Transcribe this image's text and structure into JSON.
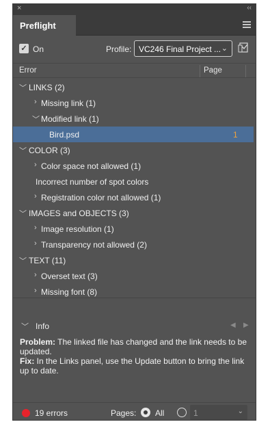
{
  "window": {
    "close_glyph": "×",
    "collapse_glyph": "‹‹"
  },
  "tabs": [
    {
      "label": "Preflight"
    }
  ],
  "menu_icon": "panel-menu-icon",
  "controls": {
    "on_label": "On",
    "on_checked": true,
    "profile_label": "Profile:",
    "profile_value": "VC246 Final Project ...",
    "profile_button_icon": "define-profiles-icon"
  },
  "columns": {
    "error": "Error",
    "page": "Page"
  },
  "rows": [
    {
      "label": "LINKS (2)",
      "expanded": true,
      "level": 0
    },
    {
      "label": "Missing link (1)",
      "expanded": false,
      "level": 1
    },
    {
      "label": "Modified link (1)",
      "expanded": true,
      "level": 1
    },
    {
      "label": "Bird.psd",
      "level": 2,
      "page": "1",
      "selected": true
    },
    {
      "label": "COLOR (3)",
      "expanded": true,
      "level": 0
    },
    {
      "label": "Color space not allowed (1)",
      "expanded": false,
      "level": 1
    },
    {
      "label": "Incorrect number of spot colors",
      "level": 1,
      "no_arrow": true
    },
    {
      "label": "Registration color not allowed (1)",
      "expanded": false,
      "level": 1
    },
    {
      "label": "IMAGES and OBJECTS (3)",
      "expanded": true,
      "level": 0
    },
    {
      "label": "Image resolution (1)",
      "expanded": false,
      "level": 1
    },
    {
      "label": "Transparency not allowed (2)",
      "expanded": false,
      "level": 1
    },
    {
      "label": "TEXT (11)",
      "expanded": true,
      "level": 0
    },
    {
      "label": "Overset text (3)",
      "expanded": false,
      "level": 1
    },
    {
      "label": "Missing font (8)",
      "expanded": false,
      "level": 1
    }
  ],
  "info": {
    "label": "Info",
    "problem_label": "Problem:",
    "problem_text": " The linked file has changed and the link needs to be updated.",
    "fix_label": "Fix:",
    "fix_text": " In the Links panel, use the Update button to bring the link up to date."
  },
  "footer": {
    "status_color": "#e8232c",
    "errors_label": "19 errors",
    "pages_label": "Pages:",
    "all_label": "All",
    "all_selected": true,
    "page_range_value": "1"
  },
  "colors": {
    "panel": "#535353",
    "selection": "#4b6e98",
    "page_number": "#f0a23a"
  }
}
